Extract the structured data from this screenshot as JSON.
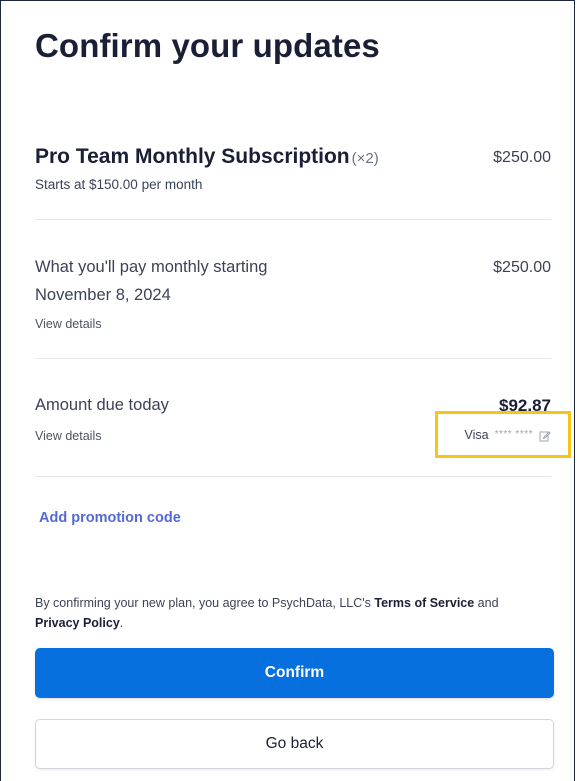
{
  "page": {
    "title": "Confirm your updates"
  },
  "subscription": {
    "name": "Pro Team Monthly Subscription",
    "quantity": "(×2)",
    "price": "$250.00",
    "starts_at": "Starts at $150.00 per month"
  },
  "monthly": {
    "label_line1": "What you'll pay monthly starting",
    "label_line2": "November 8, 2024",
    "price": "$250.00",
    "details_link": "View details"
  },
  "due_today": {
    "label": "Amount due today",
    "amount": "$92.87",
    "details_link": "View details",
    "payment": {
      "brand": "Visa",
      "masked_number": "**** ****",
      "edit_icon": "edit-icon"
    }
  },
  "promo": {
    "link": "Add promotion code"
  },
  "terms": {
    "prefix": "By confirming your new plan, you agree to PsychData, LLC's ",
    "terms_link": "Terms of Service",
    "and": " and ",
    "privacy_link": "Privacy Policy",
    "suffix": "."
  },
  "buttons": {
    "confirm": "Confirm",
    "back": "Go back"
  },
  "colors": {
    "primary": "#0570de",
    "link": "#5469d4",
    "highlight": "#f5c518"
  }
}
